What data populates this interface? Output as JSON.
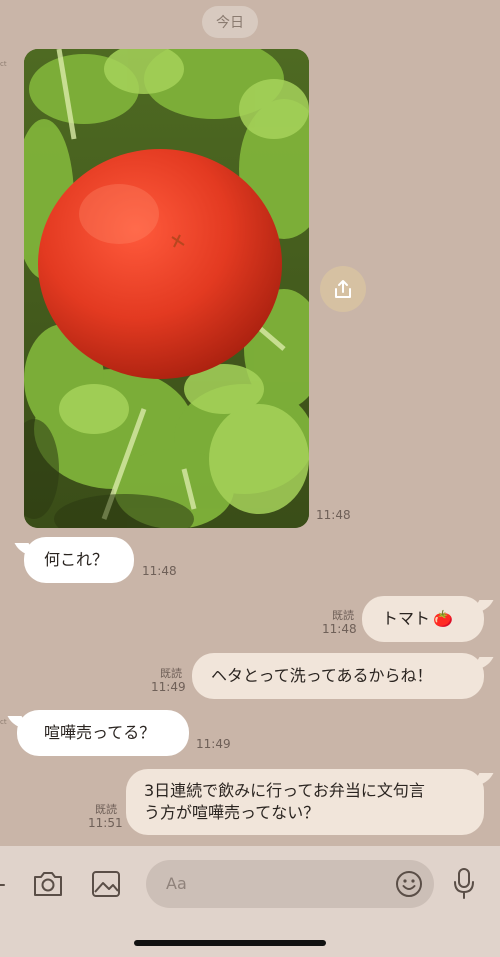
{
  "date_separator": "今日",
  "messages": [
    {
      "type": "image",
      "direction": "incoming",
      "time": "11:48",
      "alt": "tomato on salad greens"
    },
    {
      "type": "text",
      "direction": "incoming",
      "text": "何これ？",
      "time": "11:48"
    },
    {
      "type": "text",
      "direction": "outgoing",
      "text": "トマト",
      "emoji": "🍅",
      "time": "11:48",
      "read": "既読"
    },
    {
      "type": "text",
      "direction": "outgoing",
      "text": "ヘタとって洗ってあるからね！",
      "time": "11:49",
      "read": "既読"
    },
    {
      "type": "text",
      "direction": "incoming",
      "text": "喧嘩売ってる？",
      "time": "11:49"
    },
    {
      "type": "text",
      "direction": "outgoing",
      "lines": [
        "3日連続で飲みに行ってお弁当に文句言",
        "う方が喧嘩売ってない？"
      ],
      "time": "11:51",
      "read": "既読"
    }
  ],
  "composer": {
    "placeholder": "Aa",
    "icons": [
      "plus-icon",
      "camera-icon",
      "image-icon",
      "emoji-icon",
      "microphone-icon"
    ]
  },
  "colors": {
    "background": "#c9b5a8",
    "incoming_bubble": "#ffffff",
    "outgoing_bubble": "#f1e5da",
    "share_button": "#d6c1a2",
    "toolbar": "#e0d3cb"
  }
}
